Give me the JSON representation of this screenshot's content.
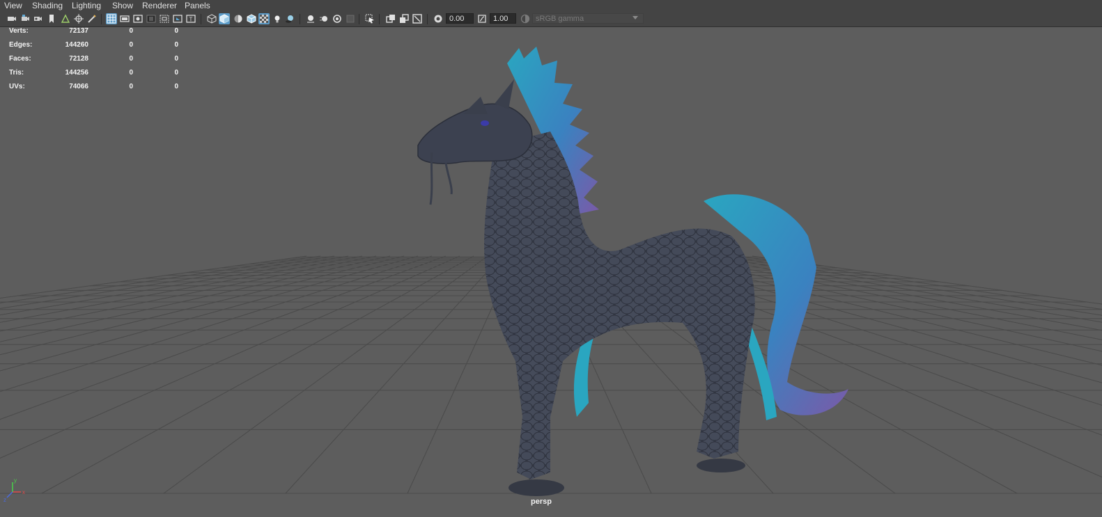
{
  "menu": [
    "View",
    "Shading",
    "Lighting",
    "Show",
    "Renderer",
    "Panels"
  ],
  "toolbar": {
    "exposure_value": "0.00",
    "gamma_value": "1.00",
    "color_space": "sRGB gamma"
  },
  "hud": {
    "rows": [
      {
        "label": "Verts:",
        "v1": "72137",
        "v2": "0",
        "v3": "0"
      },
      {
        "label": "Edges:",
        "v1": "144260",
        "v2": "0",
        "v3": "0"
      },
      {
        "label": "Faces:",
        "v1": "72128",
        "v2": "0",
        "v3": "0"
      },
      {
        "label": "Tris:",
        "v1": "144256",
        "v2": "0",
        "v3": "0"
      },
      {
        "label": "UVs:",
        "v1": "74066",
        "v2": "0",
        "v3": "0"
      }
    ]
  },
  "camera_name": "persp",
  "axis": {
    "x": "x",
    "y": "y",
    "z": "z"
  },
  "colors": {
    "panel_bg": "#444444",
    "viewport_bg": "#5d5d5d",
    "grid_line": "#4a4a4a",
    "model_body": "#3a3f4c",
    "model_fin_teal": "#2aa6c0",
    "model_fin_purple": "#7a5aa8",
    "active_button": "#5b9bc8"
  },
  "icons": [
    "camera-select-icon",
    "camera-attributes-icon",
    "camera-bookmark-icon",
    "image-plane-icon",
    "bookmark-icon",
    "2d-pan-zoom-icon",
    "grease-pencil-icon",
    "grid-icon",
    "film-gate-icon",
    "resolution-gate-icon",
    "gate-mask-icon",
    "field-chart-icon",
    "safe-action-icon",
    "safe-title-icon",
    "wireframe-icon",
    "smooth-shade-icon",
    "default-material-icon",
    "wireframe-on-shaded-icon",
    "xray-icon",
    "use-all-lights-icon",
    "shadows-icon",
    "screen-space-ao-icon",
    "motion-blur-icon",
    "multisample-aa-icon",
    "depth-of-field-icon",
    "isolate-select-icon",
    "xray-joints-icon",
    "xray-active-icon",
    "camera-frame-icon",
    "exposure-icon",
    "gamma-icon",
    "view-transform-icon"
  ]
}
